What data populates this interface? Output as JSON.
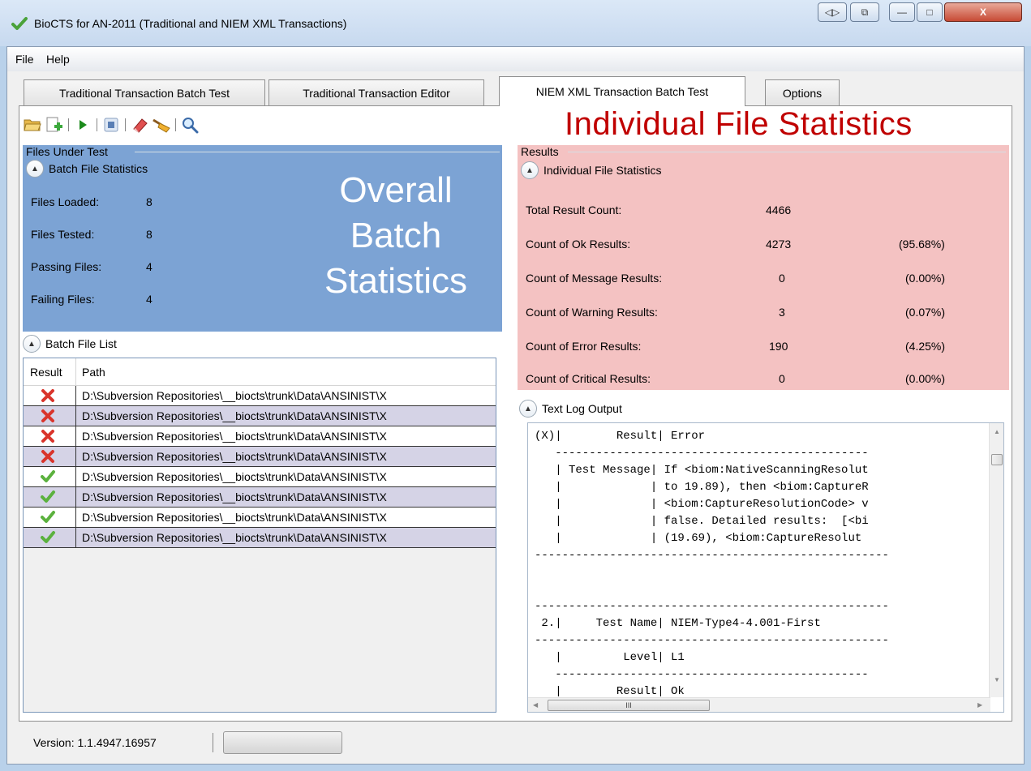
{
  "window": {
    "title": "BioCTS for AN-2011 (Traditional and NIEM XML Transactions)",
    "close_glyph": "X",
    "minimize_glyph": "—",
    "maximize_glyph": "□"
  },
  "menu": {
    "items": [
      "File",
      "Help"
    ]
  },
  "tabs": [
    {
      "label": "Traditional Transaction Batch Test",
      "active": false
    },
    {
      "label": "Traditional Transaction Editor",
      "active": false
    },
    {
      "label": "NIEM XML Transaction Batch Test",
      "active": true
    },
    {
      "label": "Options",
      "active": false
    }
  ],
  "annotation": {
    "individual": "Individual File Statistics",
    "overall_line1": "Overall",
    "overall_line2": "Batch",
    "overall_line3": "Statistics"
  },
  "files_under_test": {
    "group_label": "Files Under Test",
    "batch_stats_header": "Batch File Statistics",
    "stats": [
      {
        "label": "Files Loaded:",
        "value": "8"
      },
      {
        "label": "Files Tested:",
        "value": "8"
      },
      {
        "label": "Passing Files:",
        "value": "4"
      },
      {
        "label": "Failing Files:",
        "value": "4"
      }
    ],
    "batch_list_header": "Batch File List",
    "columns": [
      "Result",
      "Path"
    ],
    "rows": [
      {
        "result": "fail",
        "path": "D:\\Subversion Repositories\\__biocts\\trunk\\Data\\ANSINIST\\X"
      },
      {
        "result": "fail",
        "path": "D:\\Subversion Repositories\\__biocts\\trunk\\Data\\ANSINIST\\X"
      },
      {
        "result": "fail",
        "path": "D:\\Subversion Repositories\\__biocts\\trunk\\Data\\ANSINIST\\X"
      },
      {
        "result": "fail",
        "path": "D:\\Subversion Repositories\\__biocts\\trunk\\Data\\ANSINIST\\X"
      },
      {
        "result": "pass",
        "path": "D:\\Subversion Repositories\\__biocts\\trunk\\Data\\ANSINIST\\X"
      },
      {
        "result": "pass",
        "path": "D:\\Subversion Repositories\\__biocts\\trunk\\Data\\ANSINIST\\X"
      },
      {
        "result": "pass",
        "path": "D:\\Subversion Repositories\\__biocts\\trunk\\Data\\ANSINIST\\X"
      },
      {
        "result": "pass",
        "path": "D:\\Subversion Repositories\\__biocts\\trunk\\Data\\ANSINIST\\X"
      }
    ]
  },
  "results": {
    "group_label": "Results",
    "individual_header": "Individual File Statistics",
    "stats": [
      {
        "label": "Total Result Count:",
        "value": "4466",
        "pct": ""
      },
      {
        "label": "Count of Ok Results:",
        "value": "4273",
        "pct": "(95.68%)"
      },
      {
        "label": "Count of Message Results:",
        "value": "0",
        "pct": "(0.00%)"
      },
      {
        "label": "Count of Warning Results:",
        "value": "3",
        "pct": "(0.07%)"
      },
      {
        "label": "Count of Error Results:",
        "value": "190",
        "pct": "(4.25%)"
      },
      {
        "label": "Count of Critical Results:",
        "value": "0",
        "pct": "(0.00%)"
      }
    ],
    "log_header": "Text Log Output",
    "log_lines": [
      "(X)|        Result| Error",
      "   ----------------------------------------------",
      "   | Test Message| If <biom:NativeScanningResolut",
      "   |             | to 19.89), then <biom:CaptureR",
      "   |             | <biom:CaptureResolutionCode> v",
      "   |             | false. Detailed results:  [<bi",
      "   |             | (19.69), <biom:CaptureResolut",
      "----------------------------------------------------",
      "",
      "",
      "----------------------------------------------------",
      " 2.|     Test Name| NIEM-Type4-4.001-First",
      "----------------------------------------------------",
      "   |         Level| L1",
      "   ----------------------------------------------",
      "   |        Result| Ok"
    ],
    "hscroll_grip": "III"
  },
  "status": {
    "version": "Version: 1.1.4947.16957"
  },
  "colors": {
    "annotation_red": "#c00000",
    "batch_stats_bg": "#7ca3d4",
    "results_bg": "#f4c2c2",
    "fail": "#d9342b",
    "pass": "#5bb13e"
  }
}
